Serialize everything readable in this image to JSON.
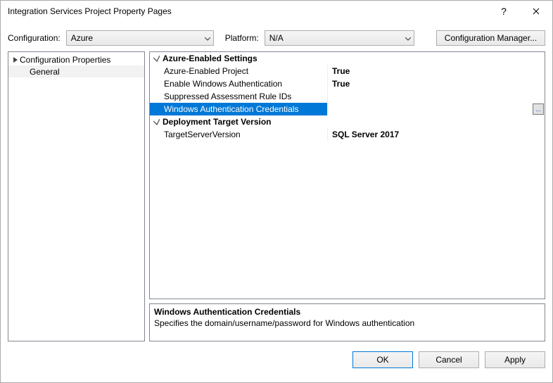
{
  "window": {
    "title": "Integration Services Project Property Pages",
    "help": "?"
  },
  "toolbar": {
    "config_label": "Configuration:",
    "config_value": "Azure",
    "platform_label": "Platform:",
    "platform_value": "N/A",
    "config_mgr": "Configuration Manager..."
  },
  "tree": {
    "root": "Configuration Properties",
    "child": "General"
  },
  "grid": {
    "cat1": "Azure-Enabled Settings",
    "p1_name": "Azure-Enabled Project",
    "p1_val": "True",
    "p2_name": "Enable Windows Authentication",
    "p2_val": "True",
    "p3_name": "Suppressed Assessment Rule IDs",
    "p3_val": "",
    "p4_name": "Windows Authentication Credentials",
    "p4_val": "",
    "ellipsis": "...",
    "cat2": "Deployment Target Version",
    "p5_name": "TargetServerVersion",
    "p5_val": "SQL Server 2017"
  },
  "desc": {
    "title": "Windows Authentication Credentials",
    "text": "Specifies the domain/username/password for Windows authentication"
  },
  "buttons": {
    "ok": "OK",
    "cancel": "Cancel",
    "apply": "Apply"
  }
}
